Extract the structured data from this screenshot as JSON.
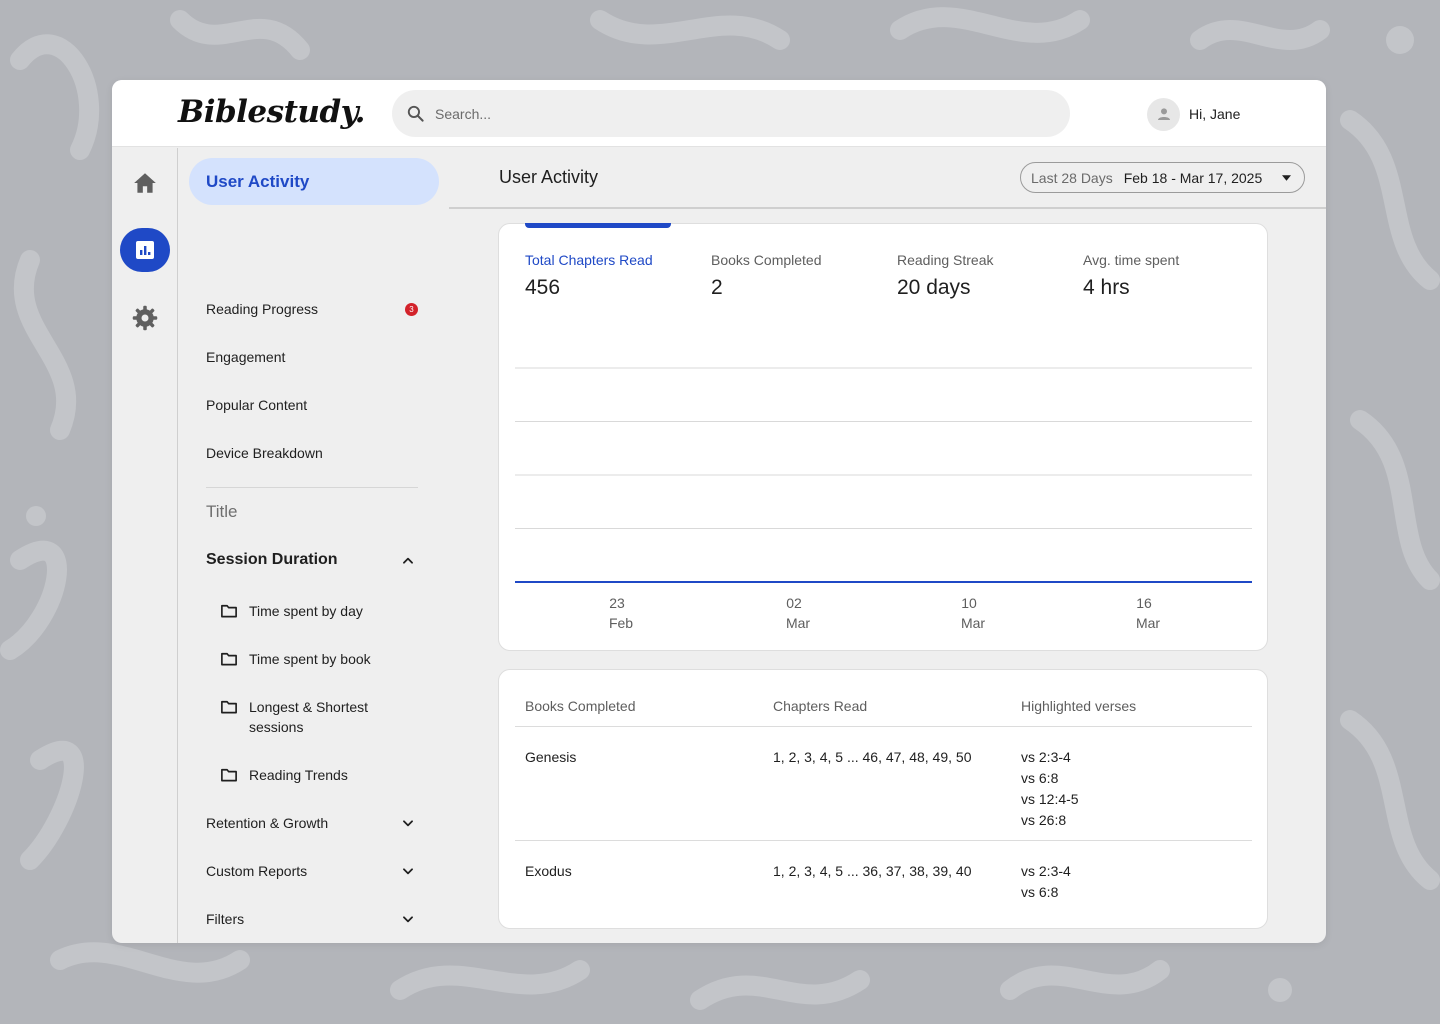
{
  "app": {
    "logo_text": "Biblestudy."
  },
  "search": {
    "placeholder": "Search..."
  },
  "user": {
    "greeting": "Hi, Jane"
  },
  "rail": {
    "items": [
      {
        "icon": "home-icon"
      },
      {
        "icon": "analytics-icon",
        "active": true
      },
      {
        "icon": "gear-icon"
      }
    ]
  },
  "sidenav": {
    "active_item": "User Activity",
    "items": [
      {
        "label": "Reading Progress",
        "badge": "3"
      },
      {
        "label": "Engagement"
      },
      {
        "label": "Popular Content"
      },
      {
        "label": "Device Breakdown"
      }
    ],
    "section_title": "Title",
    "group": {
      "label": "Session Duration",
      "expanded": true,
      "sub_items": [
        {
          "label": "Time spent by day"
        },
        {
          "label": "Time spent by book"
        },
        {
          "label": "Longest & Shortest sessions"
        },
        {
          "label": "Reading Trends"
        }
      ]
    },
    "collapsed_groups": [
      {
        "label": "Retention & Growth"
      },
      {
        "label": "Custom Reports"
      },
      {
        "label": "Filters"
      }
    ]
  },
  "main": {
    "title": "User Activity",
    "date_range": {
      "label": "Last 28 Days",
      "value": "Feb 18 - Mar 17, 2025"
    }
  },
  "kpis": [
    {
      "label": "Total Chapters Read",
      "value": "456",
      "active": true
    },
    {
      "label": "Books Completed",
      "value": "2"
    },
    {
      "label": "Reading Streak",
      "value": "20 days"
    },
    {
      "label": "Avg. time spent",
      "value": "4 hrs"
    }
  ],
  "chart_data": {
    "type": "line",
    "x_ticks": [
      {
        "day": "23",
        "month": "Feb"
      },
      {
        "day": "02",
        "month": "Mar"
      },
      {
        "day": "10",
        "month": "Mar"
      },
      {
        "day": "16",
        "month": "Mar"
      }
    ],
    "series": [
      {
        "values": [
          0,
          0,
          0,
          0
        ]
      }
    ],
    "grid": true,
    "line_color": "#1f49c6"
  },
  "table": {
    "headers": [
      "Books Completed",
      "Chapters Read",
      "Highlighted verses"
    ],
    "rows": [
      {
        "book": "Genesis",
        "chapters": "1, 2, 3, 4, 5 ... 46, 47, 48, 49, 50",
        "verses": [
          "vs 2:3-4",
          "vs 6:8",
          "vs 12:4-5",
          "vs 26:8"
        ]
      },
      {
        "book": "Exodus",
        "chapters": "1, 2, 3, 4, 5 ... 36, 37, 38, 39, 40",
        "verses": [
          "vs 2:3-4",
          "vs 6:8"
        ]
      }
    ]
  },
  "colors": {
    "accent": "#1f49c6",
    "active_bg": "#d4e2fd",
    "badge": "#d3222a"
  }
}
